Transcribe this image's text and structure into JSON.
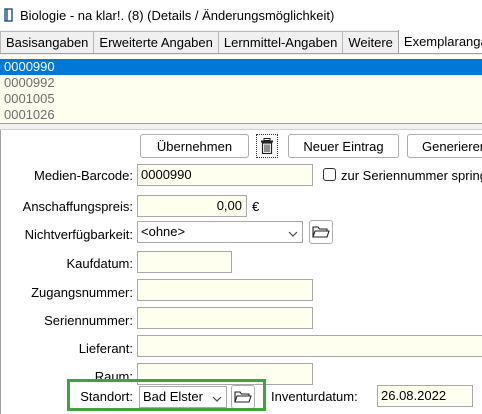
{
  "window": {
    "title": "Biologie - na klar!. (8) (Details / Änderungsmöglichkeit)",
    "icon": "book-icon"
  },
  "tabs": [
    {
      "label": "Basisangaben",
      "active": false
    },
    {
      "label": "Erweiterte Angaben",
      "active": false
    },
    {
      "label": "Lernmittel-Angaben",
      "active": false
    },
    {
      "label": "Weitere",
      "active": false
    },
    {
      "label": "Exemplarangaben",
      "active": true
    }
  ],
  "copies_list": [
    "0000990",
    "0000992",
    "0001005",
    "0001026"
  ],
  "selected_copy": "0000990",
  "toolbar": {
    "apply_label": "Übernehmen",
    "new_entry_label": "Neuer Eintrag",
    "generate_label": "Generieren"
  },
  "form": {
    "barcode_label": "Medien-Barcode:",
    "barcode_value": "0000990",
    "serial_checkbox_label": "zur Seriennummer springen",
    "price_label": "Anschaffungspreis:",
    "price_value": "0,00",
    "currency": "€",
    "unavailable_label": "Nichtverfügbarkeit:",
    "unavailable_value": "<ohne>",
    "purchase_date_label": "Kaufdatum:",
    "purchase_date_value": "",
    "accession_label": "Zugangsnummer:",
    "accession_value": "",
    "serial_label": "Seriennummer:",
    "serial_value": "",
    "supplier_label": "Lieferant:",
    "supplier_value": "",
    "room_label": "Raum:",
    "room_value": "",
    "location_label": "Standort:",
    "location_value": "Bad Elster",
    "inventory_date_label": "Inventurdatum:",
    "inventory_date_value": "26.08.2022"
  },
  "colors": {
    "selection": "#0078d7",
    "field_bg": "#fffff0",
    "highlight": "#3ea53e"
  }
}
